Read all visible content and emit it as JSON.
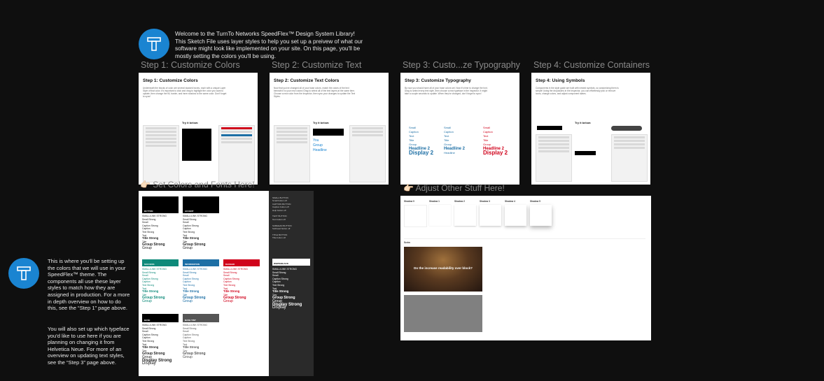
{
  "intro": {
    "text": "Welcome to the TurnTo Networks SpeedFlex™ Design System Library! This Sketch File uses layer styles to help you set up a preivew of what our software might look like implemented on your site. On this page, you'll be mostly setting the colors you'll be using."
  },
  "side_note": {
    "para1": "This is where you'll be setting up the colors that we will use in your SpeedFlex™ theme. The components all use these layer styles to match how they are assigned in production. For a more in depth overview on how to do this, see the “Step 1” page above.",
    "para2": "You will also set up which typeface you'd like to use here if you are planning on changing it from Helvetica Neue. For more of an overview on updating text styles, see the “Step 3” page above."
  },
  "steps": [
    {
      "label": "Step 1: Customize Colors",
      "card_title": "Step 1: Customize Colors",
      "card_text": "Underneath the blocks of color are several stacked boxes, each with a unique Layer Style of that color. It's important to click and drag to highlight the color you want to update, then change the fill, border, and inner shadow to the same color. Don't forget to sync!"
    },
    {
      "label": "Step 2: Customize Text",
      "card_title": "Step 2: Customize Text Colors",
      "card_text": "Now that you've changed all of your base colors, match the colors of the text beneath it to your new colors! Drag to select all of the text layers at the same time. Choose a new color from the Inspector, then sync your changes to update the Text Styles."
    },
    {
      "label": "Step 3: Custo...ze Typography",
      "card_title": "Step 3: Customize Typography",
      "card_text": "By now you should have all of your base colors set. Now it's time to change the font. Drag to select every text style, then choose a new typeface in the Inspector. It might take a couple seconds to update. When they've changed, don't forget to sync!"
    },
    {
      "label": "Step 4: Customize Containers",
      "card_title": "Step 4: Using Symbols",
      "card_text": "Components in the style guide are built with nested symbols, so customizing them is simple! Using the dropdowns in the Inspector, you can effortlessly pick or remove icons, change colors, and adjust component states."
    }
  ],
  "try_label": "Try it below:",
  "sections": {
    "colors": "👉🏻  Set Colors and Fonts Here!",
    "other": "👉🏻  Adjust Other Stuff Here!"
  },
  "swatches": {
    "row1": [
      {
        "name": "BUTTON",
        "color": "#000000"
      },
      {
        "name": "ACCENT",
        "color": "#000000"
      }
    ],
    "row2": [
      {
        "name": "SUCCESS",
        "color": "#0e8a7a"
      },
      {
        "name": "INFORMATION",
        "color": "#1d6fa5"
      },
      {
        "name": "DANGER",
        "color": "#d0021b"
      }
    ],
    "row3": [
      {
        "name": "BASE",
        "color": "#000000"
      },
      {
        "name": "BASE TINT",
        "color": "#555555"
      }
    ]
  },
  "type_styles": [
    "Tiny",
    "Group Strong",
    "Group",
    "Display Strong",
    "Display"
  ],
  "dark_panel": {
    "items": [
      "SMALL BUTTON",
      "CAPTION BUTTON",
      "TEXT BUTTON",
      "SUBHEAD BUTTON",
      "TITLE BUTTON"
    ],
    "swatch": "WHITE/BLACK",
    "styles": [
      "Title Strong",
      "Tiny",
      "Group Strong",
      "Group",
      "Display Strong",
      "Display"
    ]
  },
  "shadows": [
    "Shadow 0",
    "Shadow 1",
    "Shadow 2",
    "Shadow 3",
    "Shadow 4",
    "Shadow 5"
  ],
  "scrim": {
    "label": "Scrim",
    "headline": "Do the increase readability over block?"
  },
  "colors": {
    "logo_blue": "#1a84d1",
    "background": "#0f0f0f"
  }
}
